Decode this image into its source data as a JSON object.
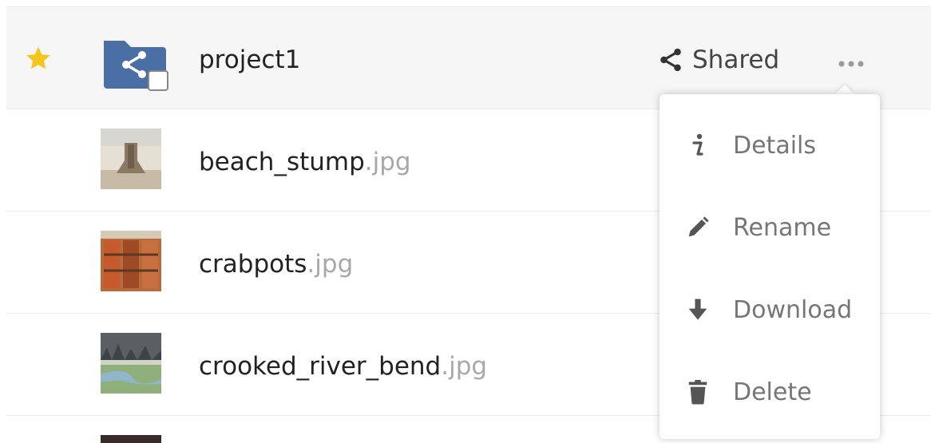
{
  "files": [
    {
      "base": "project1",
      "ext": "",
      "type": "shared-folder",
      "starred": true,
      "selected": true
    },
    {
      "base": "beach_stump",
      "ext": ".jpg",
      "type": "image"
    },
    {
      "base": "crabpots",
      "ext": ".jpg",
      "type": "image"
    },
    {
      "base": "crooked_river_bend",
      "ext": ".jpg",
      "type": "image"
    }
  ],
  "shared_label": "Shared",
  "menu": {
    "details": "Details",
    "rename": "Rename",
    "download": "Download",
    "delete": "Delete"
  },
  "icons": {
    "star": "star-icon",
    "share": "share-icon",
    "more": "more-icon",
    "info": "info-icon",
    "pencil": "pencil-icon",
    "download": "download-icon",
    "trash": "trash-icon"
  },
  "colors": {
    "star": "#f5c518",
    "folder": "#4a6fa5",
    "selected_row": "#f6f6f6",
    "ext": "#a8a8a8",
    "menu_text": "#767676"
  }
}
